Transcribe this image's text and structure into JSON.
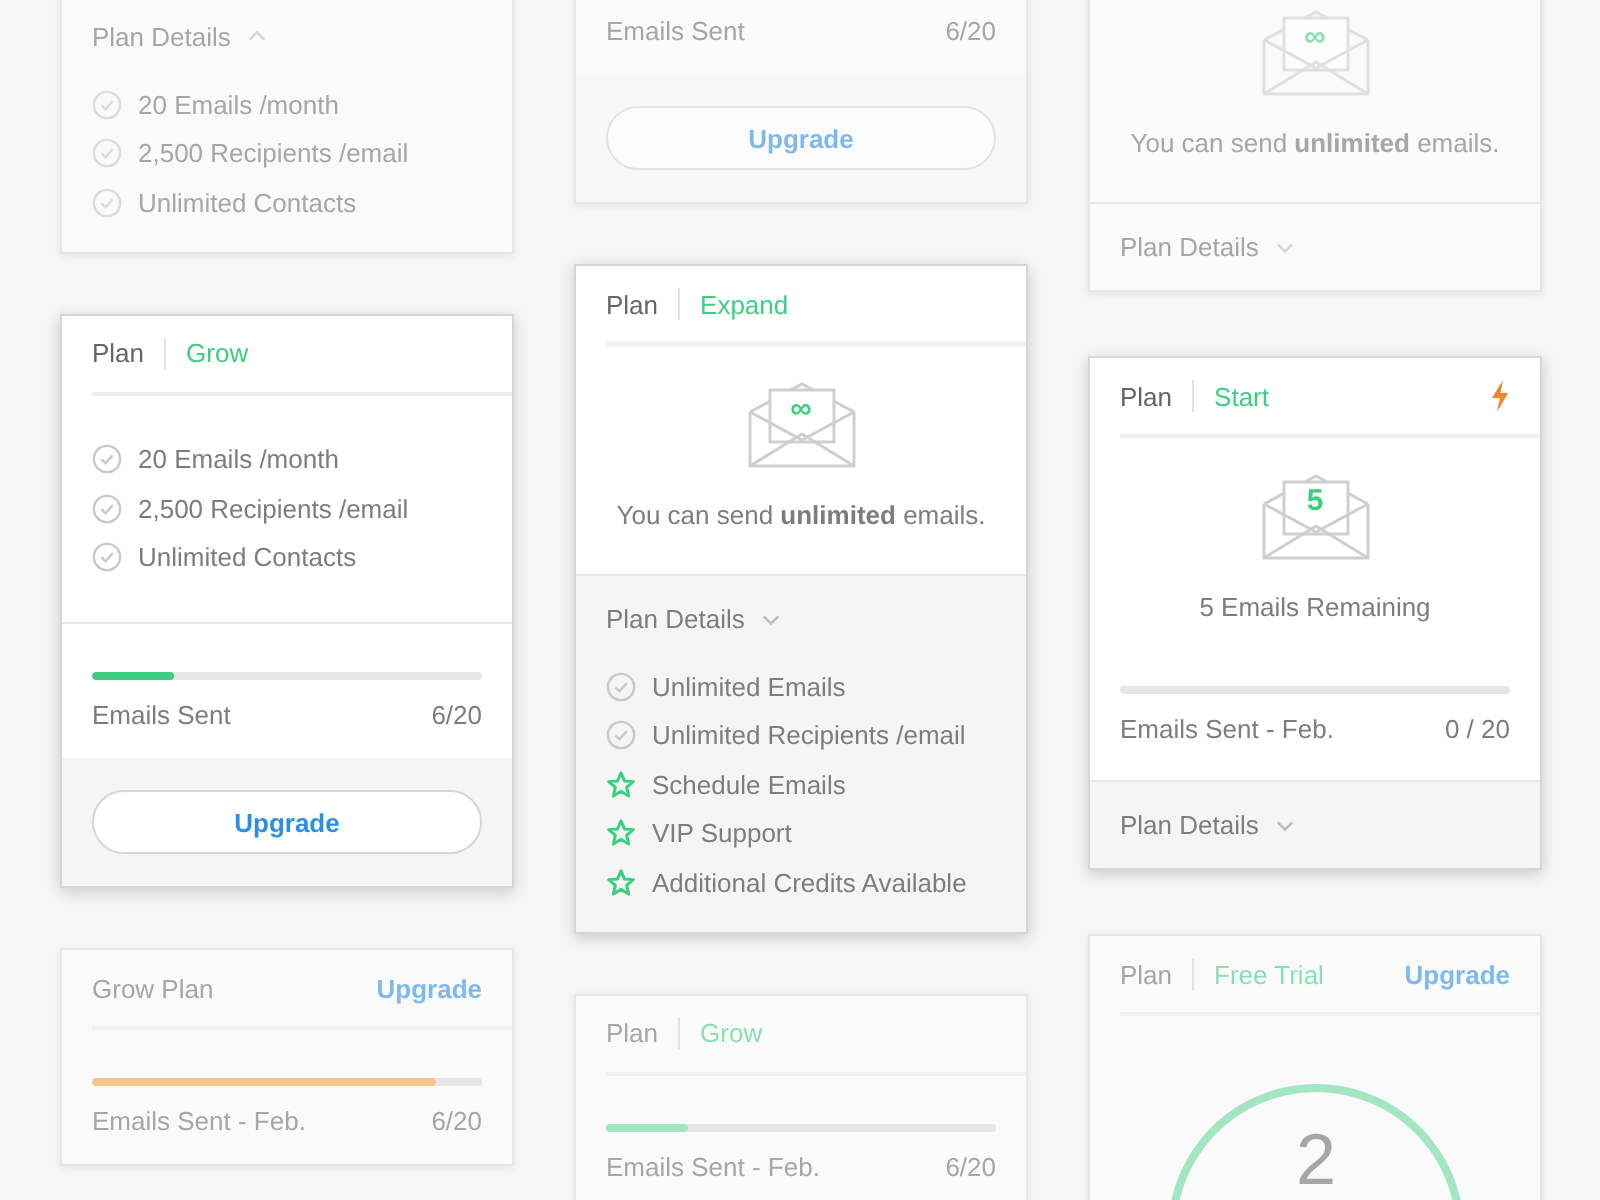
{
  "columns": [
    {
      "cards": [
        {
          "dimmed": true,
          "sections": [
            {
              "kind": "toggle",
              "text": "Plan Details",
              "expanded": true,
              "ruled": false
            },
            {
              "kind": "features",
              "items": [
                {
                  "kind": "check",
                  "text": "20 Emails /month"
                },
                {
                  "kind": "check",
                  "text": "2,500 Recipients /email"
                },
                {
                  "kind": "check",
                  "text": "Unlimited Contacts"
                }
              ]
            }
          ]
        },
        {
          "dimmed": false,
          "sections": [
            {
              "kind": "header",
              "label": "Plan",
              "name": "Grow"
            },
            {
              "kind": "features",
              "items": [
                {
                  "kind": "check",
                  "text": "20 Emails /month"
                },
                {
                  "kind": "check",
                  "text": "2,500 Recipients /email"
                },
                {
                  "kind": "check",
                  "text": "Unlimited Contacts"
                }
              ]
            },
            {
              "kind": "usage",
              "label": "Emails Sent",
              "value": "6/20",
              "track": true,
              "level": 0.21,
              "color": "#3dcf80",
              "ruled": true
            },
            {
              "kind": "action",
              "button": "Upgrade"
            }
          ]
        },
        {
          "dimmed": true,
          "sections": [
            {
              "kind": "header",
              "label": "Grow Plan",
              "action": "Upgrade"
            },
            {
              "kind": "usage",
              "label": "Emails Sent - Feb.",
              "value": "6/20",
              "track": true,
              "level": 0.88,
              "color": "#f8c68c",
              "ruled": false
            }
          ]
        }
      ]
    },
    {
      "cards": [
        {
          "dimmed": true,
          "sections": [
            {
              "kind": "usage",
              "label": "Emails Sent",
              "value": "6/20",
              "ruled": false
            },
            {
              "kind": "action",
              "button": "Upgrade"
            }
          ]
        },
        {
          "dimmed": false,
          "sections": [
            {
              "kind": "header",
              "label": "Plan",
              "name": "Expand"
            },
            {
              "kind": "envelope",
              "mark": "∞",
              "message": "You can send **unlimited** emails."
            },
            {
              "kind": "toggle",
              "text": "Plan Details",
              "expanded": false,
              "shaded": true,
              "ruled": true
            },
            {
              "kind": "features",
              "shaded": true,
              "items": [
                {
                  "kind": "check",
                  "text": "Unlimited Emails"
                },
                {
                  "kind": "check",
                  "text": "Unlimited Recipients /email"
                },
                {
                  "kind": "star",
                  "text": "Schedule Emails"
                },
                {
                  "kind": "star",
                  "text": "VIP Support"
                },
                {
                  "kind": "star",
                  "text": "Additional Credits Available"
                }
              ]
            }
          ]
        },
        {
          "dimmed": true,
          "sections": [
            {
              "kind": "header",
              "label": "Plan",
              "name": "Grow"
            },
            {
              "kind": "usage",
              "label": "Emails Sent - Feb.",
              "value": "6/20",
              "track": true,
              "level": 0.21,
              "color": "#a3e6c2",
              "ruled": false
            }
          ]
        }
      ]
    },
    {
      "cards": [
        {
          "dimmed": true,
          "sections": [
            {
              "kind": "envelope",
              "mark": "∞",
              "message": "You can send **unlimited** emails."
            },
            {
              "kind": "toggle",
              "text": "Plan Details",
              "expanded": false,
              "ruled": true
            }
          ]
        },
        {
          "dimmed": false,
          "sections": [
            {
              "kind": "header",
              "label": "Plan",
              "name": "Start",
              "flagged": true
            },
            {
              "kind": "envelope",
              "mark": "5",
              "message": "5 Emails Remaining"
            },
            {
              "kind": "usage",
              "label": "Emails Sent - Feb.",
              "value": "0 / 20",
              "track": true,
              "ruled": false
            },
            {
              "kind": "toggle",
              "text": "Plan Details",
              "expanded": false,
              "shaded": true,
              "ruled": true
            }
          ]
        },
        {
          "dimmed": true,
          "sections": [
            {
              "kind": "header",
              "label": "Plan",
              "name": "Free Trial",
              "action": "Upgrade"
            },
            {
              "kind": "gauge",
              "value": "2",
              "level": 0.95,
              "color": "#a3e6c2"
            }
          ]
        }
      ]
    }
  ]
}
